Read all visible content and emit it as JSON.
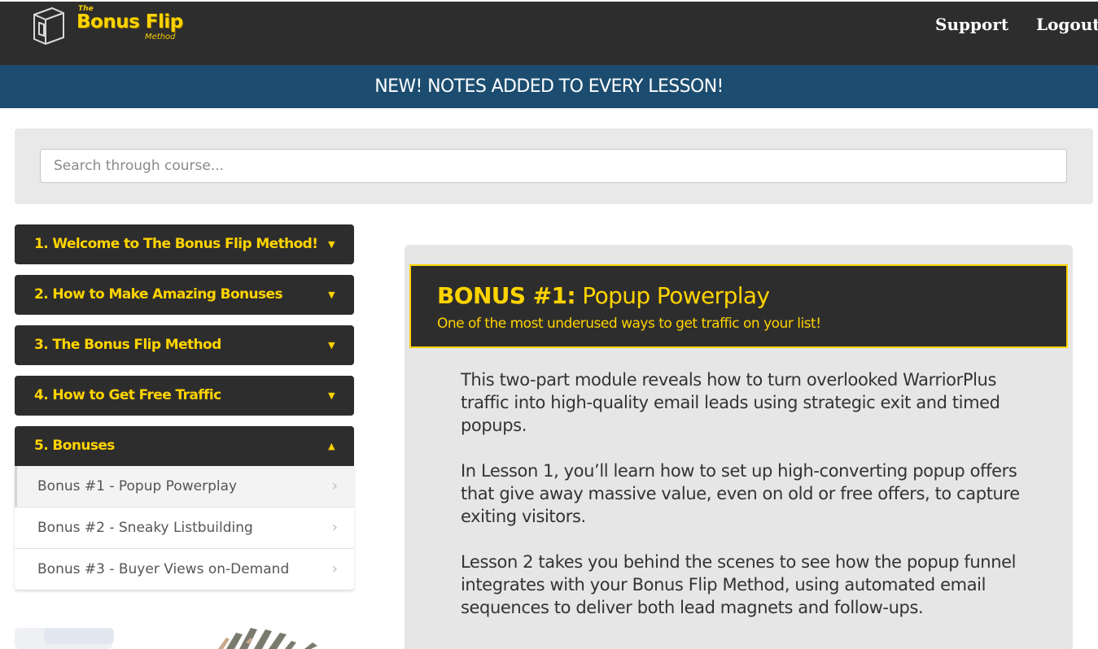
{
  "header": {
    "logo": {
      "the": "The",
      "main": "Bonus Flip",
      "method": "Method"
    },
    "nav": {
      "support": "Support",
      "logout": "Logout"
    }
  },
  "banner": {
    "text": "NEW! NOTES ADDED TO EVERY LESSON!"
  },
  "search": {
    "placeholder": "Search through course..."
  },
  "sidebar": {
    "modules": [
      {
        "label": "1. Welcome to The Bonus Flip Method!",
        "state": "collapsed"
      },
      {
        "label": "2. How to Make Amazing Bonuses",
        "state": "collapsed"
      },
      {
        "label": "3. The Bonus Flip Method",
        "state": "collapsed"
      },
      {
        "label": "4. How to Get Free Traffic",
        "state": "collapsed"
      },
      {
        "label": "5. Bonuses",
        "state": "expanded"
      }
    ],
    "lessons": [
      {
        "label": "Bonus #1 - Popup Powerplay",
        "active": true
      },
      {
        "label": "Bonus #2 - Sneaky Listbuilding",
        "active": false
      },
      {
        "label": "Bonus #3 - Buyer Views on-Demand",
        "active": false
      }
    ]
  },
  "main": {
    "title_prefix": "BONUS #1:",
    "title_name": "Popup Powerplay",
    "subtitle": "One of the most underused ways to get traffic on your list!",
    "paragraphs": [
      "This two-part module reveals how to turn overlooked WarriorPlus traffic into high-quality email leads using strategic exit and timed popups.",
      "In Lesson 1, you’ll learn how to set up high-converting popup offers that give away massive value, even on old or free offers, to capture exiting visitors.",
      "Lesson 2 takes you behind the scenes to see how the popup funnel integrates with your Bonus Flip Method, using automated email sequences to deliver both lead magnets and follow-ups."
    ]
  },
  "colors": {
    "dark": "#2e2d2d",
    "accent": "#ffd400",
    "banner": "#1c4d70",
    "panel": "#e6e6e6"
  },
  "icons": {
    "collapsed": "caret-down-icon",
    "expanded": "caret-up-icon",
    "lesson": "chevron-right-icon"
  }
}
